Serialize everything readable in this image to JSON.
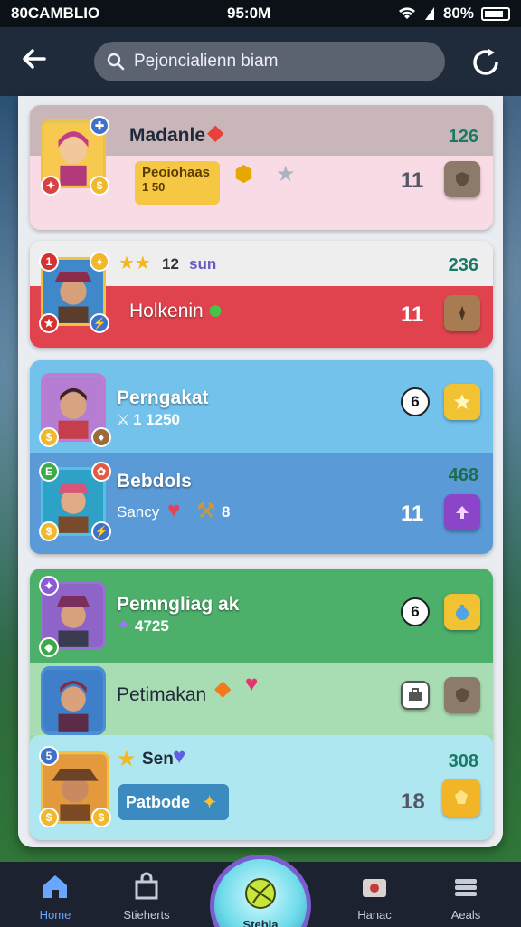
{
  "status": {
    "carrier": "80CAMBLIO",
    "time": "95:0M",
    "battery": "80%"
  },
  "search": {
    "placeholder": "Pejoncialienn biam"
  },
  "players": [
    {
      "name": "Madanle",
      "tag": "Peoiohaas",
      "tag_value": "1 50",
      "level": "11",
      "score": "126"
    },
    {
      "stars": "12",
      "rank_note": "sun",
      "name": "Holkenin",
      "level": "11",
      "score": "236"
    },
    {
      "name": "Perngakat",
      "stat": "1 1250",
      "round": "6"
    },
    {
      "name": "Bebdols",
      "sub": "Sancy",
      "sub_count": "8",
      "level": "11",
      "score": "468"
    },
    {
      "name": "Pemngliag ak",
      "stat": "4725",
      "round": "6"
    },
    {
      "name": "Petimakan"
    },
    {
      "name": "Sen",
      "button": "Patbode",
      "level": "18",
      "score": "308"
    }
  ],
  "nav": {
    "home": "Home",
    "stickers": "Stieherts",
    "center": "Stebia",
    "hanac": "Hanac",
    "aeals": "Aeals"
  },
  "colors": {
    "accent_blue": "#6aa6ff",
    "card_pink": "#f9dbe6",
    "card_red": "#e0434e",
    "card_blue": "#6cbfe8",
    "card_green": "#4caf6a"
  }
}
